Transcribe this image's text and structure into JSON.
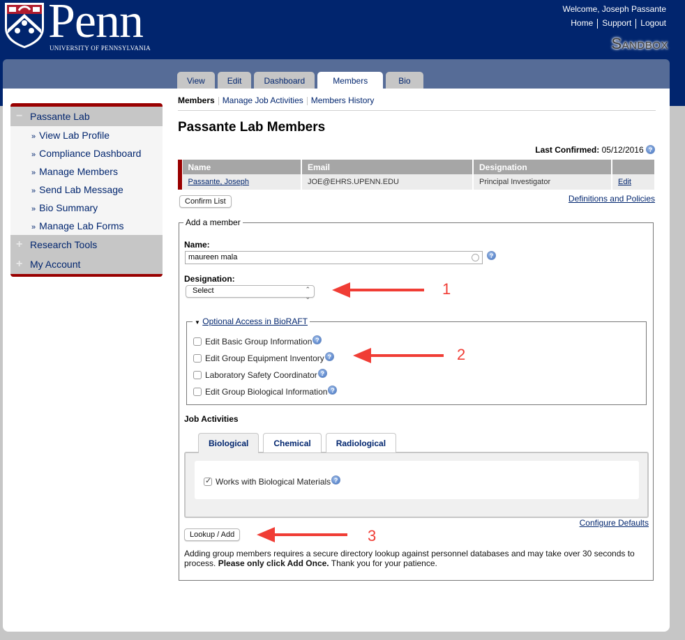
{
  "header": {
    "logo_text": "Penn",
    "logo_subtitle": "University of Pennsylvania",
    "welcome": "Welcome, Joseph Passante",
    "links": [
      "Home",
      "Support",
      "Logout"
    ],
    "environment_badge": "Sandbox"
  },
  "tabs": [
    {
      "label": "View",
      "active": false
    },
    {
      "label": "Edit",
      "active": false
    },
    {
      "label": "Dashboard",
      "active": false
    },
    {
      "label": "Members",
      "active": true
    },
    {
      "label": "Bio",
      "active": false
    }
  ],
  "sidebar": {
    "sections": [
      {
        "label": "Passante Lab",
        "expanded": true,
        "symbol": "−",
        "items": [
          "View Lab Profile",
          "Compliance Dashboard",
          "Manage Members",
          "Send Lab Message",
          "Bio Summary",
          "Manage Lab Forms"
        ]
      },
      {
        "label": "Research Tools",
        "expanded": false,
        "symbol": "+"
      },
      {
        "label": "My Account",
        "expanded": false,
        "symbol": "+"
      }
    ]
  },
  "subnav": {
    "items": [
      "Members",
      "Manage Job Activities",
      "Members History"
    ],
    "current": "Members"
  },
  "page_title": "Passante Lab Members",
  "last_confirmed": {
    "label": "Last Confirmed:",
    "value": "05/12/2016"
  },
  "members_table": {
    "columns": [
      "Name",
      "Email",
      "Designation",
      ""
    ],
    "rows": [
      {
        "name": "Passante, Joseph",
        "email": "JOE@EHRS.UPENN.EDU",
        "designation": "Principal Investigator",
        "action": "Edit"
      }
    ]
  },
  "confirm_list_label": "Confirm List",
  "definitions_link": "Definitions and Policies",
  "add_member": {
    "legend": "Add a member",
    "name_label": "Name:",
    "name_value": "maureen mala",
    "designation_label": "Designation:",
    "designation_value": "Select",
    "optional_access": {
      "legend": "Optional Access in BioRAFT",
      "options": [
        {
          "label": "Edit Basic Group Information",
          "checked": false
        },
        {
          "label": "Edit Group Equipment Inventory",
          "checked": false
        },
        {
          "label": "Laboratory Safety Coordinator",
          "checked": false
        },
        {
          "label": "Edit Group Biological Information",
          "checked": false
        }
      ]
    },
    "job_activities": {
      "label": "Job Activities",
      "tabs": [
        "Biological",
        "Chemical",
        "Radiological"
      ],
      "active_tab": "Biological",
      "options": [
        {
          "label": "Works with Biological Materials",
          "checked": true
        }
      ]
    },
    "configure_defaults": "Configure Defaults",
    "lookup_button": "Lookup / Add",
    "note_prefix": "Adding group members requires a secure directory lookup against personnel databases and may take over 30 seconds to process. ",
    "note_bold": "Please only click Add Once.",
    "note_suffix": " Thank you for your patience."
  },
  "annotations": [
    {
      "number": "1",
      "target": "designation-select"
    },
    {
      "number": "2",
      "target": "optional-access"
    },
    {
      "number": "3",
      "target": "lookup-add-button"
    }
  ],
  "colors": {
    "brand_blue": "#01256e",
    "brand_red": "#990000",
    "annotation_red": "#f03d35"
  }
}
